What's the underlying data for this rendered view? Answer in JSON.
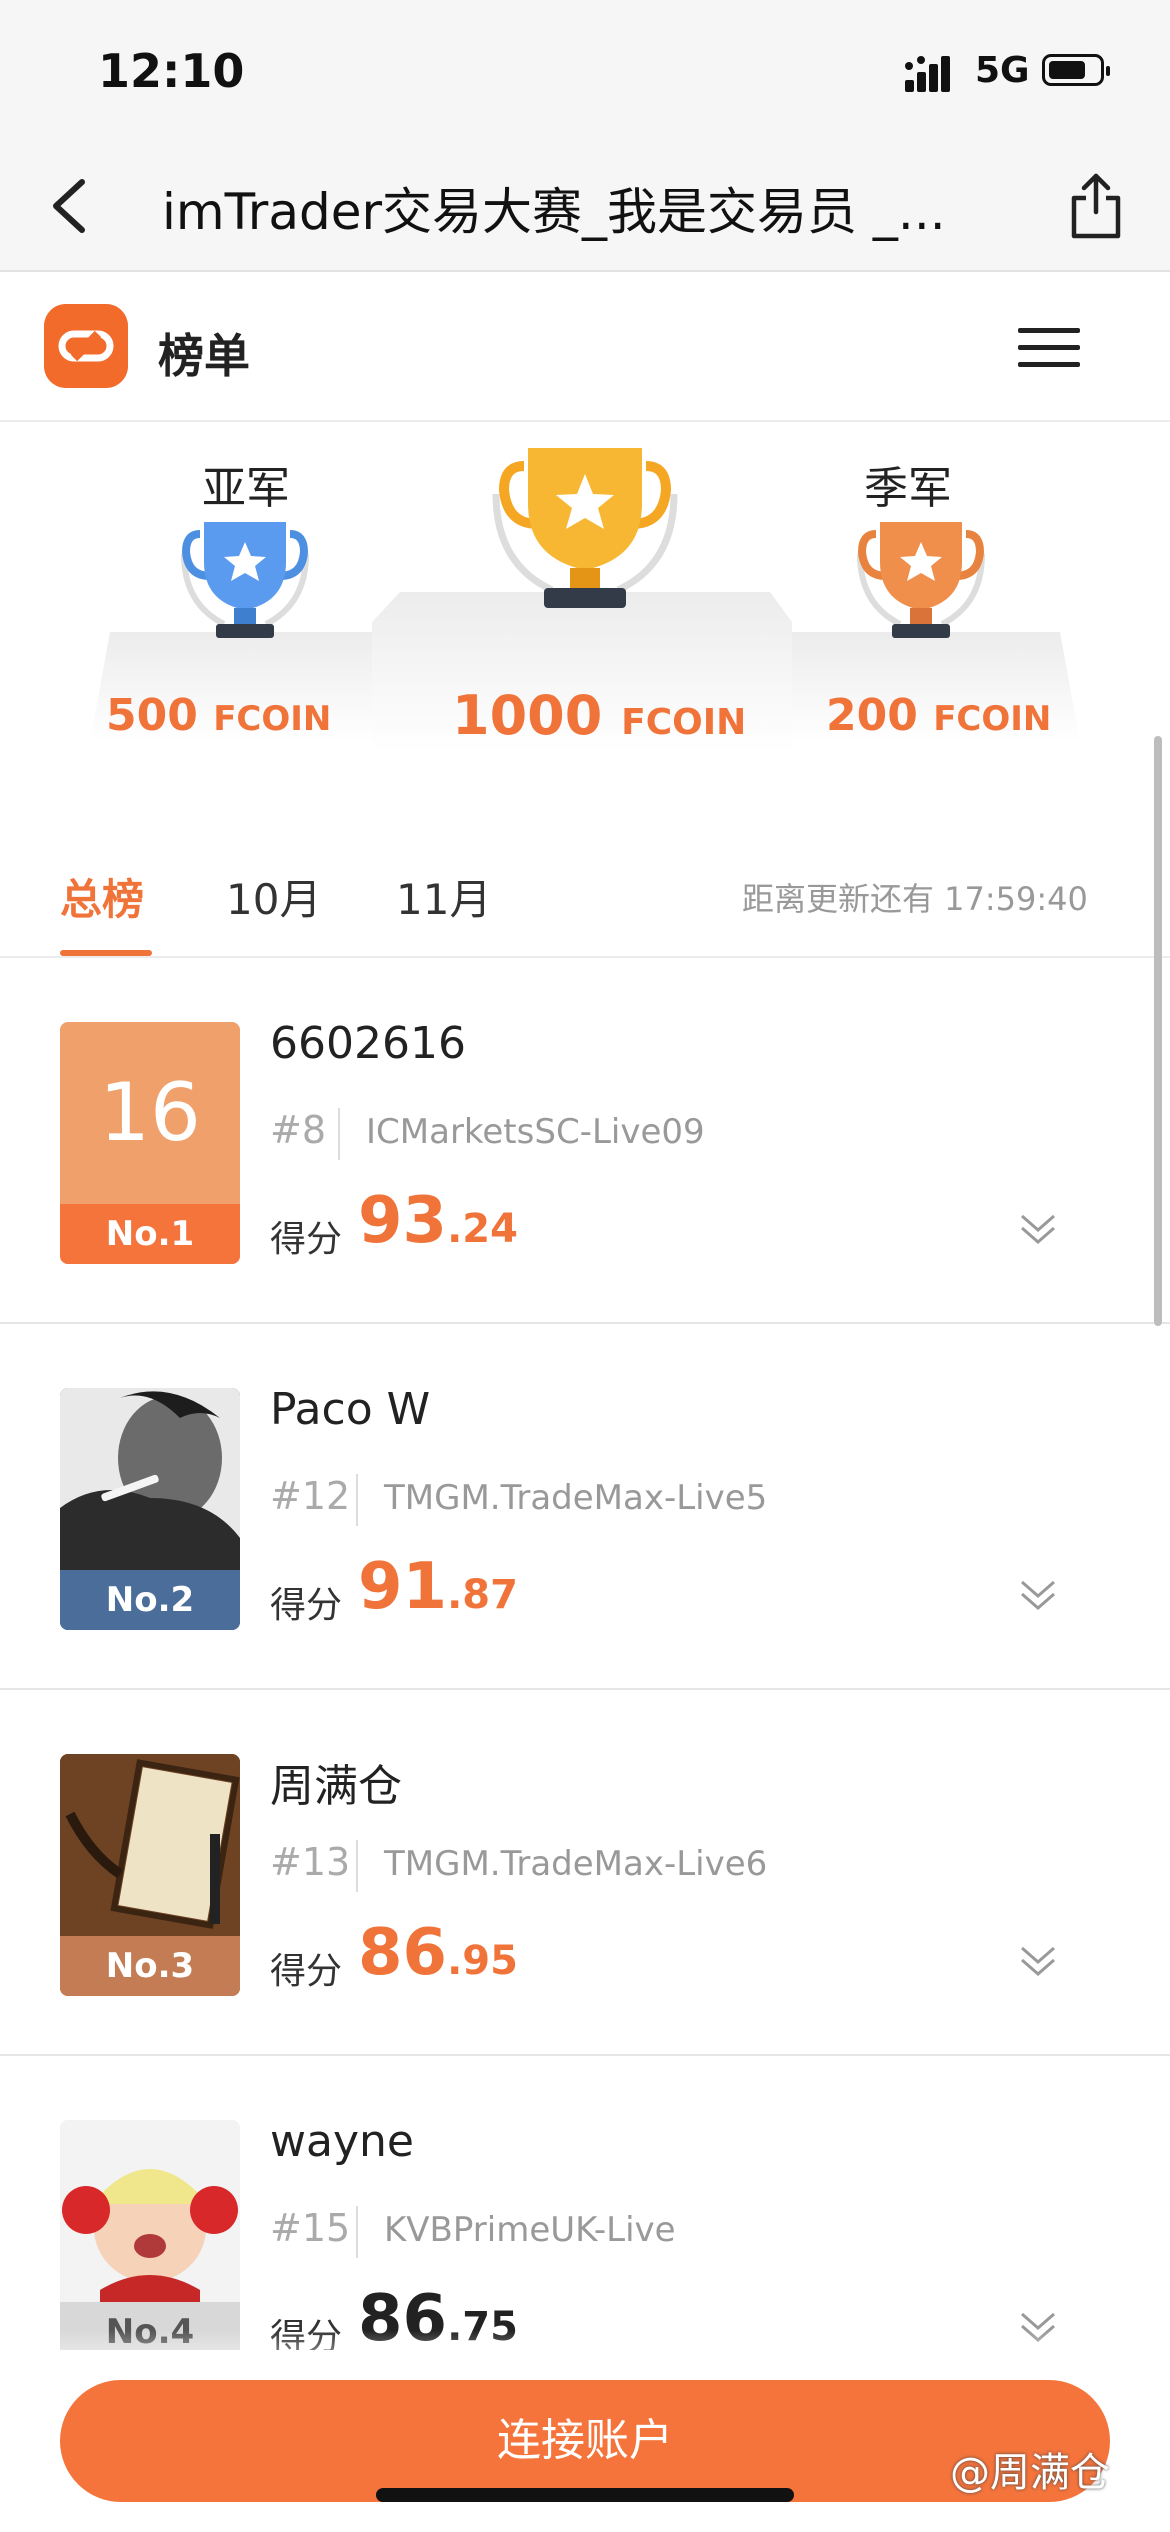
{
  "status_bar": {
    "time": "12:10",
    "network": "5G"
  },
  "nav": {
    "title": "imTrader交易大赛_我是交易员 _..."
  },
  "header": {
    "title": "榜单"
  },
  "podium": {
    "second": {
      "label": "亚军",
      "prize_amount": "500",
      "prize_unit": "FCOIN"
    },
    "first": {
      "prize_amount": "1000",
      "prize_unit": "FCOIN"
    },
    "third": {
      "label": "季军",
      "prize_amount": "200",
      "prize_unit": "FCOIN"
    }
  },
  "tabs": [
    {
      "label": "总榜",
      "active": true
    },
    {
      "label": "10月",
      "active": false
    },
    {
      "label": "11月",
      "active": false
    }
  ],
  "countdown": "距离更新还有 17:59:40",
  "score_label": "得分",
  "rows": [
    {
      "avatar_text": "16",
      "rank_label": "No.1",
      "rank_color": "#f4743c",
      "name": "6602616",
      "tag": "#8",
      "server": "ICMarketsSC-Live09",
      "score_int": "93",
      "score_dec": ".24",
      "score_color": "#f0743a"
    },
    {
      "avatar_text": "",
      "rank_label": "No.2",
      "rank_color": "#4a6d99",
      "name": "Paco W",
      "tag": "#12",
      "server": "TMGM.TradeMax-Live5",
      "score_int": "91",
      "score_dec": ".87",
      "score_color": "#f0743a"
    },
    {
      "avatar_text": "",
      "rank_label": "No.3",
      "rank_color": "#c47c54",
      "name": "周满仓",
      "tag": "#13",
      "server": "TMGM.TradeMax-Live6",
      "score_int": "86",
      "score_dec": ".95",
      "score_color": "#f0743a"
    },
    {
      "avatar_text": "",
      "rank_label": "No.4",
      "rank_color": "#d8d8d8",
      "name": "wayne",
      "tag": "#15",
      "server": "KVBPrimeUK-Live",
      "score_int": "86",
      "score_dec": ".75",
      "score_color": "#222222"
    }
  ],
  "connect_button": "连接账户",
  "watermark": "@周满仓"
}
